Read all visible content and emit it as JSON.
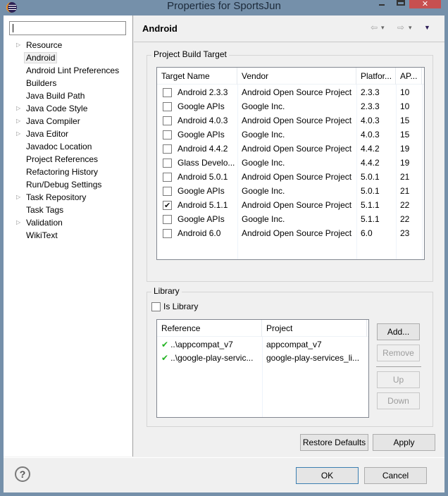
{
  "window": {
    "title": "Properties for SportsJun",
    "close_label": "✕"
  },
  "sidebar": {
    "filter_value": "",
    "items": [
      {
        "label": "Resource",
        "expandable": true
      },
      {
        "label": "Android",
        "expandable": false,
        "selected": true
      },
      {
        "label": "Android Lint Preferences",
        "expandable": false
      },
      {
        "label": "Builders",
        "expandable": false
      },
      {
        "label": "Java Build Path",
        "expandable": false
      },
      {
        "label": "Java Code Style",
        "expandable": true
      },
      {
        "label": "Java Compiler",
        "expandable": true
      },
      {
        "label": "Java Editor",
        "expandable": true
      },
      {
        "label": "Javadoc Location",
        "expandable": false
      },
      {
        "label": "Project References",
        "expandable": false
      },
      {
        "label": "Refactoring History",
        "expandable": false
      },
      {
        "label": "Run/Debug Settings",
        "expandable": false
      },
      {
        "label": "Task Repository",
        "expandable": true
      },
      {
        "label": "Task Tags",
        "expandable": false
      },
      {
        "label": "Validation",
        "expandable": true
      },
      {
        "label": "WikiText",
        "expandable": false
      }
    ]
  },
  "page": {
    "title": "Android",
    "nav": {
      "back": "⇦",
      "forward": "⇨",
      "dropdown": "▾",
      "menu": "▼"
    }
  },
  "build_target": {
    "group_label": "Project Build Target",
    "columns": [
      "Target Name",
      "Vendor",
      "Platfor...",
      "AP..."
    ],
    "rows": [
      {
        "name": "Android 2.3.3",
        "vendor": "Android Open Source Project",
        "platform": "2.3.3",
        "api": "10",
        "checked": false
      },
      {
        "name": "Google APIs",
        "vendor": "Google Inc.",
        "platform": "2.3.3",
        "api": "10",
        "checked": false
      },
      {
        "name": "Android 4.0.3",
        "vendor": "Android Open Source Project",
        "platform": "4.0.3",
        "api": "15",
        "checked": false
      },
      {
        "name": "Google APIs",
        "vendor": "Google Inc.",
        "platform": "4.0.3",
        "api": "15",
        "checked": false
      },
      {
        "name": "Android 4.4.2",
        "vendor": "Android Open Source Project",
        "platform": "4.4.2",
        "api": "19",
        "checked": false
      },
      {
        "name": "Glass Develo...",
        "vendor": "Google Inc.",
        "platform": "4.4.2",
        "api": "19",
        "checked": false
      },
      {
        "name": "Android 5.0.1",
        "vendor": "Android Open Source Project",
        "platform": "5.0.1",
        "api": "21",
        "checked": false
      },
      {
        "name": "Google APIs",
        "vendor": "Google Inc.",
        "platform": "5.0.1",
        "api": "21",
        "checked": false
      },
      {
        "name": "Android 5.1.1",
        "vendor": "Android Open Source Project",
        "platform": "5.1.1",
        "api": "22",
        "checked": true
      },
      {
        "name": "Google APIs",
        "vendor": "Google Inc.",
        "platform": "5.1.1",
        "api": "22",
        "checked": false
      },
      {
        "name": "Android 6.0",
        "vendor": "Android Open Source Project",
        "platform": "6.0",
        "api": "23",
        "checked": false
      }
    ]
  },
  "library": {
    "group_label": "Library",
    "is_library_label": "Is Library",
    "is_library_checked": false,
    "columns": [
      "Reference",
      "Project"
    ],
    "rows": [
      {
        "reference": "..\\appcompat_v7",
        "project": "appcompat_v7"
      },
      {
        "reference": "..\\google-play-servic...",
        "project": "google-play-services_li..."
      }
    ],
    "buttons": {
      "add": "Add...",
      "remove": "Remove",
      "up": "Up",
      "down": "Down"
    }
  },
  "actions": {
    "restore_defaults": "Restore Defaults",
    "apply": "Apply"
  },
  "footer": {
    "help": "?",
    "ok": "OK",
    "cancel": "Cancel"
  }
}
